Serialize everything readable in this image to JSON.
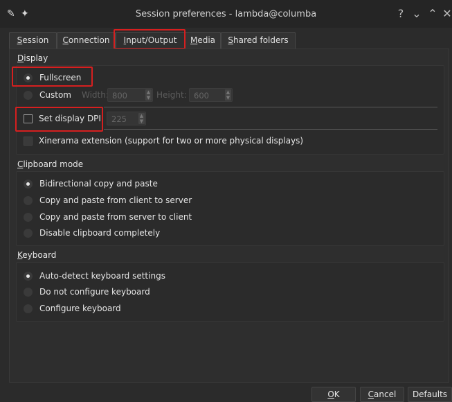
{
  "window": {
    "title": "Session preferences - lambda@columba",
    "buttons": {
      "help": "?",
      "minimize": "⌄",
      "maximize": "⌃",
      "close": "✕"
    }
  },
  "tabs": [
    {
      "mn": "S",
      "rest": "ession"
    },
    {
      "mn": "C",
      "rest": "onnection"
    },
    {
      "mn": "I",
      "rest": "nput/Output"
    },
    {
      "mn": "M",
      "rest": "edia"
    },
    {
      "mn": "S",
      "rest": "hared folders"
    }
  ],
  "active_tab": "Input/Output",
  "display": {
    "title_mn": "D",
    "title_rest": "isplay",
    "fullscreen": "Fullscreen",
    "custom": "Custom",
    "width_label": "Width:",
    "width_value": "800",
    "height_label": "Height:",
    "height_value": "600",
    "set_dpi": "Set display DPI",
    "dpi_value": "225",
    "xinerama": "Xinerama extension (support for two or more physical displays)"
  },
  "clipboard": {
    "title_mn": "C",
    "title_rest": "lipboard mode",
    "options": [
      "Bidirectional copy and paste",
      "Copy and paste from client to server",
      "Copy and paste from server to client",
      "Disable clipboard completely"
    ],
    "selected": 0
  },
  "keyboard": {
    "title_mn": "K",
    "title_rest": "eyboard",
    "options": [
      "Auto-detect keyboard settings",
      "Do not configure keyboard",
      "Configure keyboard"
    ],
    "selected": 0
  },
  "footer": {
    "ok": {
      "mn": "O",
      "rest": "K"
    },
    "cancel": {
      "mn": "C",
      "rest": "ancel"
    },
    "defaults": "Defaults"
  },
  "colors": {
    "highlight": "#d61f1f",
    "background": "#2b2b2b"
  }
}
